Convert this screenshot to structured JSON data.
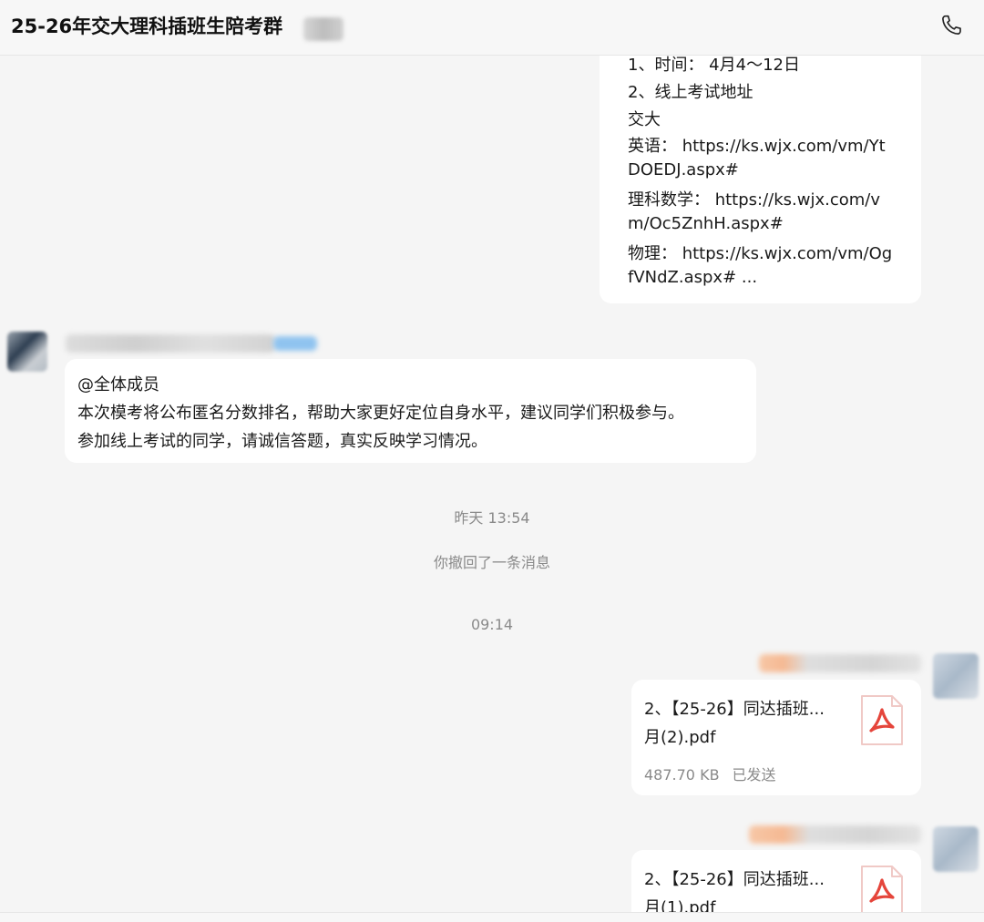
{
  "header": {
    "title": "25-26年交大理科插班生陪考群",
    "call_icon": "phone-icon"
  },
  "messages": [
    {
      "lines": [
        "1、时间： 4月4～12日",
        "2、线上考试地址",
        "交大",
        "英语： https://ks.wjx.com/vm/Yt",
        "DOEDJ.aspx#",
        "理科数学： https://ks.wjx.com/v",
        "m/Oc5ZnhH.aspx#",
        "物理： https://ks.wjx.com/vm/Og",
        "fVNdZ.aspx# ..."
      ]
    },
    {
      "lines": [
        "@全体成员",
        "本次模考将公布匿名分数排名，帮助大家更好定位自身水平，建议同学们积极参与。",
        "参加线上考试的同学，请诚信答题，真实反映学习情况。"
      ]
    }
  ],
  "timestamps": {
    "yesterday": "昨天 13:54",
    "today": "09:14"
  },
  "system_notice": "你撤回了一条消息",
  "files": [
    {
      "name_line1": "2、【25-26】同达插班...",
      "name_line2": "月(2).pdf",
      "size": "487.70 KB",
      "status": "已发送",
      "icon": "pdf-icon"
    },
    {
      "name_line1": "2、【25-26】同达插班...",
      "name_line2": "月(1).pdf",
      "icon": "pdf-icon"
    }
  ],
  "colors": {
    "background": "#f5f5f5",
    "bubble": "#ffffff",
    "pdf_red": "#e5453b",
    "meta_text": "#8a8a8a"
  }
}
